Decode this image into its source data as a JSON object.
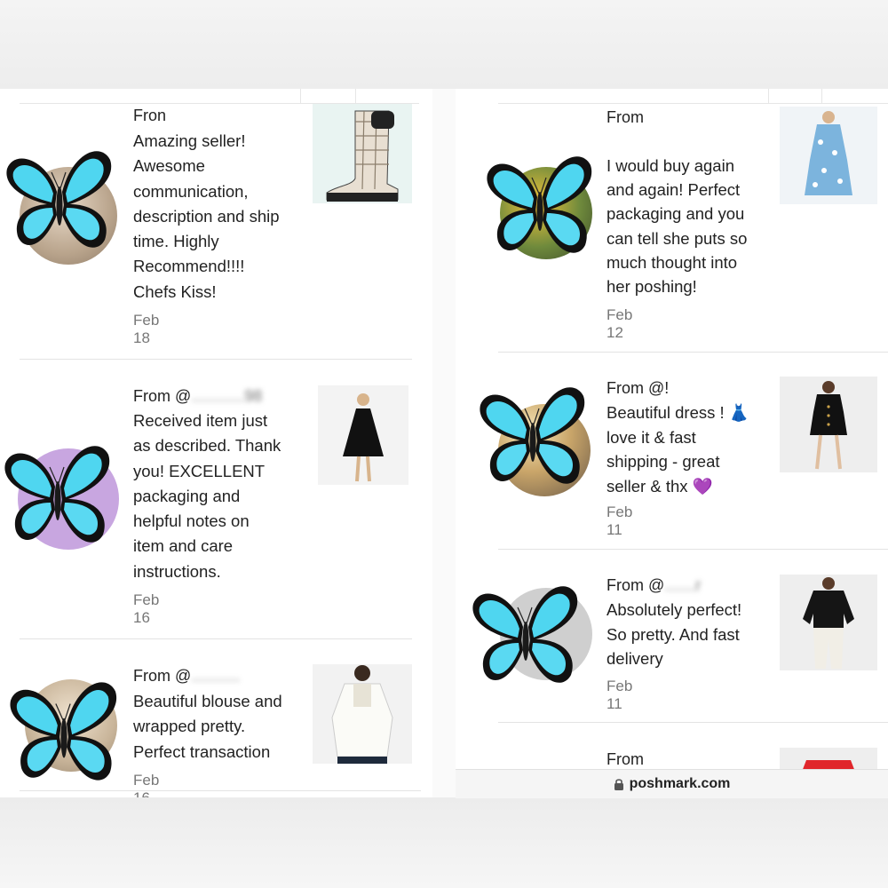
{
  "url_bar": {
    "domain": "poshmark.com",
    "icon": "lock-icon"
  },
  "colors": {
    "butterfly_blue": "#4fd6f0",
    "butterfly_dark": "#111111",
    "date_gray": "#777777"
  },
  "reviews_left": [
    {
      "from_label": "Fron",
      "handle": "",
      "text_lines": [
        "Amazing seller!",
        "Awesome",
        "communication,",
        "description and ship",
        "time. Highly",
        "Recommend!!!!",
        "Chefs Kiss!"
      ],
      "date": "Feb 18",
      "item": "plaid rain boot"
    },
    {
      "from_label": "From @",
      "handle": "............98",
      "text_lines": [
        "Received item just",
        "as described. Thank",
        "you! EXCELLENT",
        "packaging and",
        "helpful notes on",
        "item and care",
        "instructions."
      ],
      "date": "Feb 16",
      "item": "black tiered dress"
    },
    {
      "from_label": "From @",
      "handle": "...........",
      "text_lines": [
        "Beautiful blouse and",
        "wrapped pretty.",
        "Perfect transaction"
      ],
      "date": "Feb 16",
      "item": "white blouse"
    }
  ],
  "reviews_right": [
    {
      "from_label": "From",
      "handle": "",
      "text_lines": [
        "I would buy again",
        "and again! Perfect",
        "packaging and you",
        "can tell she puts so",
        "much thought into",
        "her poshing!"
      ],
      "date": "Feb 12",
      "item": "blue floral dress"
    },
    {
      "from_label": "From @!",
      "handle": "",
      "text_lines": [
        "Beautiful dress ! 👗",
        "love it & fast",
        "shipping - great",
        "seller & thx 💜"
      ],
      "date": "Feb 11",
      "item": "black mini dress"
    },
    {
      "from_label": "From @",
      "handle": ".......r",
      "text_lines": [
        "Absolutely perfect!",
        "So pretty. And fast",
        "delivery"
      ],
      "date": "Feb 11",
      "item": "black top white pants"
    },
    {
      "from_label": "From",
      "handle": "",
      "text_lines": [],
      "date": "",
      "item": "red top"
    }
  ]
}
